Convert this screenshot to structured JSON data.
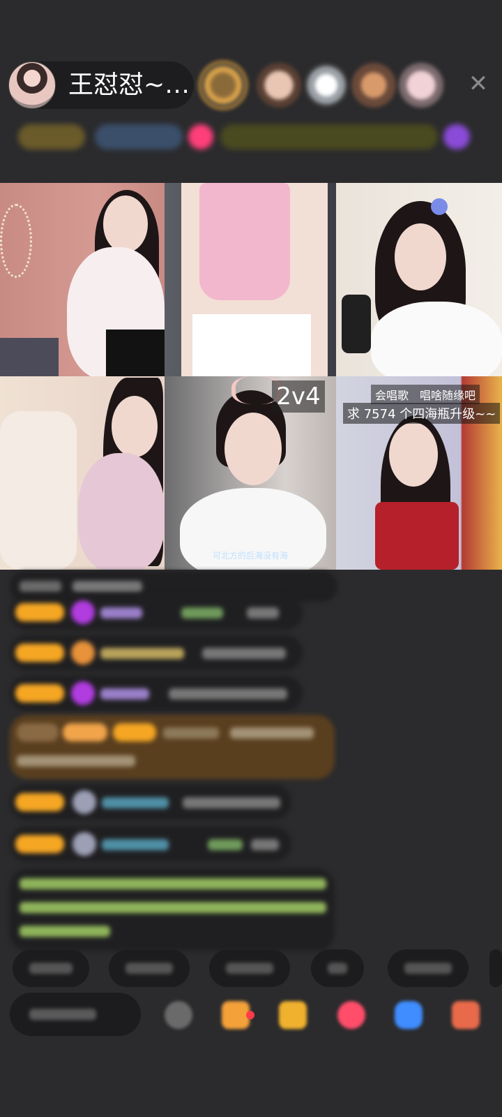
{
  "host": {
    "name": "王怼怼~…"
  },
  "header": {
    "close_label": "✕"
  },
  "grid": {
    "pk_label": "2v4",
    "tile5_caption": "可北方的后海没有海",
    "tile6_sticker_line1": "会唱歌　唱啥随缘吧",
    "tile6_sticker_line2": "求 7574 个四海瓶升级~~"
  },
  "colors": {
    "background": "#2b2b2d",
    "chat_bubble": "#1f1f21",
    "vip_badge": "#f5a623",
    "gift_message_bg": "#5a3f1f"
  }
}
